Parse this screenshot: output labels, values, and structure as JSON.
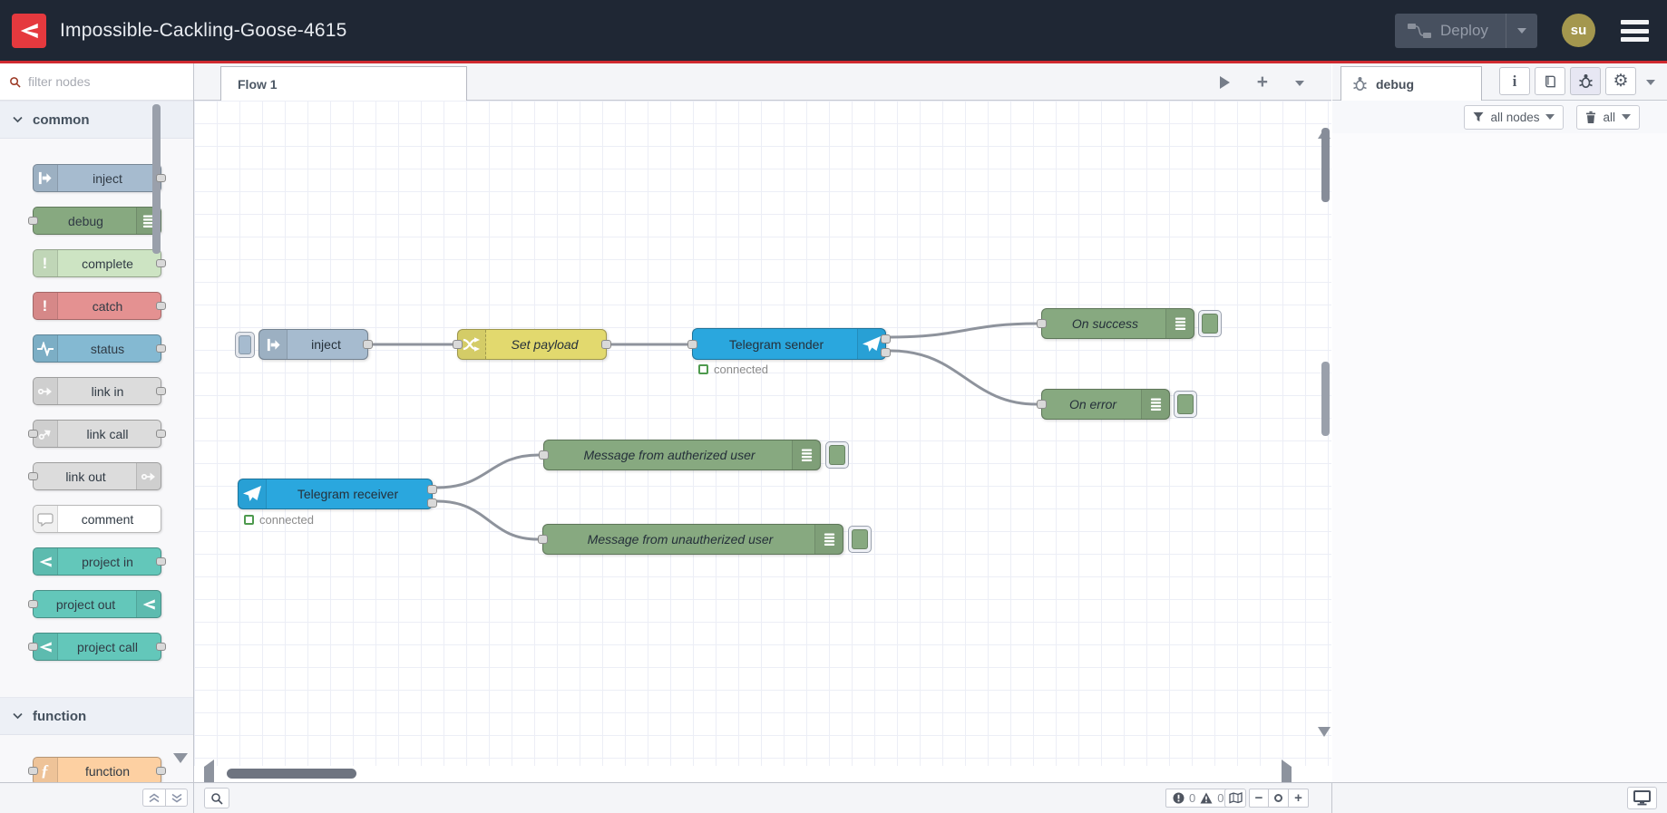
{
  "header": {
    "title": "Impossible-Cackling-Goose-4615",
    "deploy": {
      "label": "Deploy"
    },
    "user": {
      "initials": "su"
    },
    "colors": {
      "header_bg": "#1f2734",
      "accent_red": "#cf2a30",
      "logo_red": "#e5393e",
      "avatar_bg": "#a4974e"
    }
  },
  "palette": {
    "filter": {
      "placeholder": "filter nodes"
    },
    "categories": [
      {
        "label": "common",
        "items": [
          {
            "label": "inject",
            "color": "#a6bbcf"
          },
          {
            "label": "debug",
            "color": "#87a980"
          },
          {
            "label": "complete",
            "color": "#cde4c3"
          },
          {
            "label": "catch",
            "color": "#e49191"
          },
          {
            "label": "status",
            "color": "#84b9d2"
          },
          {
            "label": "link in",
            "color": "#dcdcdc"
          },
          {
            "label": "link call",
            "color": "#dcdcdc"
          },
          {
            "label": "link out",
            "color": "#dcdcdc"
          },
          {
            "label": "comment",
            "color": "#ffffff"
          },
          {
            "label": "project in",
            "color": "#63c7ba"
          },
          {
            "label": "project out",
            "color": "#63c7ba"
          },
          {
            "label": "project call",
            "color": "#63c7ba"
          }
        ]
      },
      {
        "label": "function",
        "items": [
          {
            "label": "function",
            "color": "#fdd0a2"
          }
        ]
      }
    ]
  },
  "workspace": {
    "tab": {
      "label": "Flow 1"
    },
    "nodes": [
      {
        "label": "inject",
        "type": "inject",
        "color": "#a6bbcf"
      },
      {
        "label": "Set payload",
        "type": "change",
        "color": "#e2d96e"
      },
      {
        "label": "Telegram sender",
        "type": "telegram-sender",
        "color": "#2aa7de",
        "status": "connected"
      },
      {
        "label": "On success",
        "type": "debug",
        "color": "#87a980"
      },
      {
        "label": "On error",
        "type": "debug",
        "color": "#87a980"
      },
      {
        "label": "Telegram receiver",
        "type": "telegram-receiver",
        "color": "#2aa7de",
        "status": "connected"
      },
      {
        "label": "Message from autherized user",
        "type": "debug",
        "color": "#87a980"
      },
      {
        "label": "Message from unautherized user",
        "type": "debug",
        "color": "#87a980"
      }
    ]
  },
  "sidebar": {
    "tab": {
      "label": "debug"
    },
    "filter": {
      "label": "all nodes"
    },
    "clear": {
      "label": "all"
    }
  },
  "statusbar": {
    "errors": "0",
    "warnings": "0"
  }
}
